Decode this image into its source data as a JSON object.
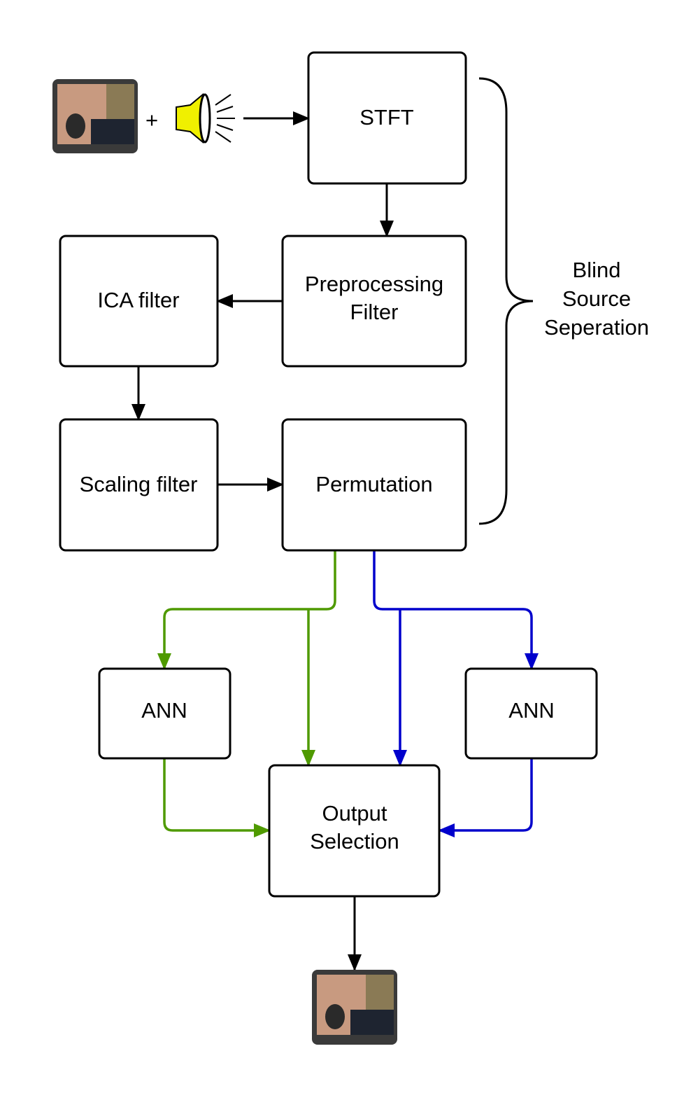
{
  "boxes": {
    "stft": "STFT",
    "preprocessing_line1": "Preprocessing",
    "preprocessing_line2": "Filter",
    "ica": "ICA filter",
    "scaling": "Scaling filter",
    "permutation": "Permutation",
    "ann_left": "ANN",
    "ann_right": "ANN",
    "output_line1": "Output",
    "output_line2": "Selection"
  },
  "input_plus": "+",
  "brace_label": [
    "Blind",
    "Source",
    "Seperation"
  ],
  "colors": {
    "green_path": "#4f9a00",
    "blue_path": "#0000cc",
    "default": "#000000"
  },
  "icons": {
    "input_video": "video-monitor-speaker",
    "input_audio": "loudspeaker",
    "output_video": "video-monitor-speaker"
  }
}
